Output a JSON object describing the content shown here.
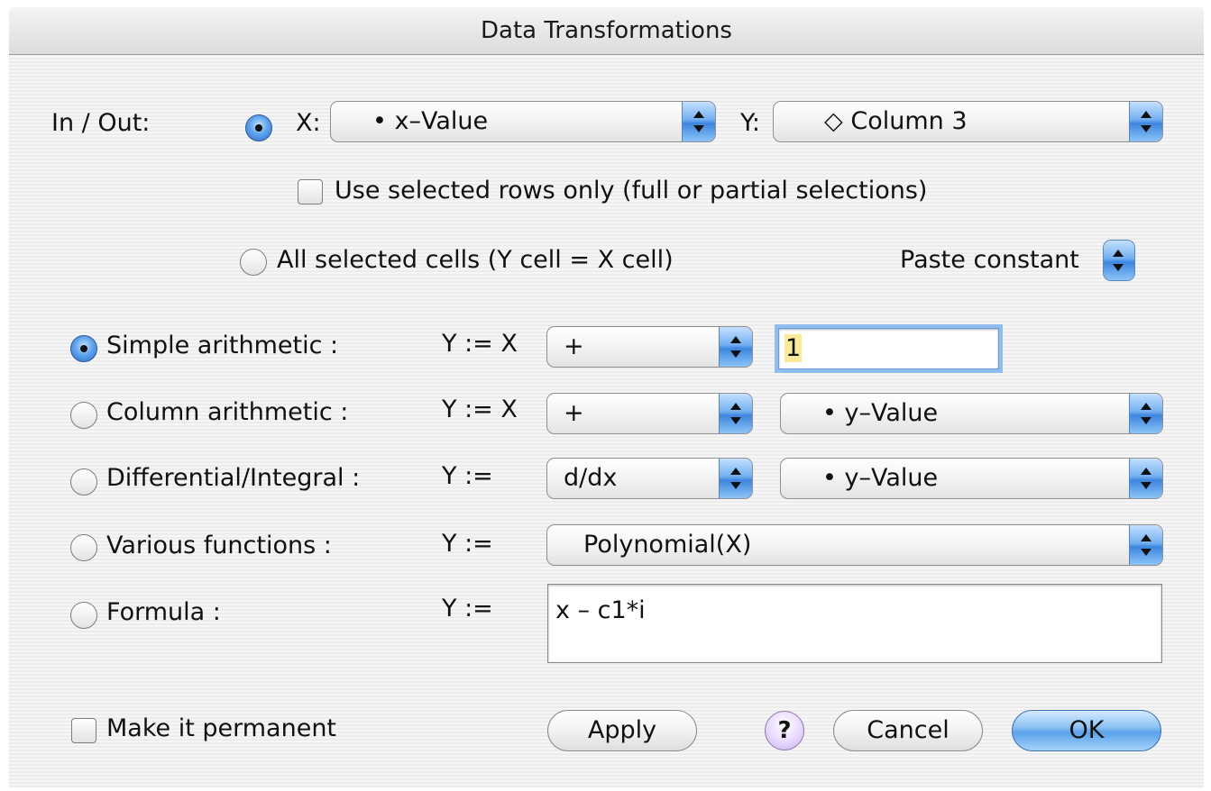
{
  "window": {
    "title": "Data Transformations"
  },
  "inout": {
    "label": "In / Out:",
    "x_label": "X:",
    "x_value": "• x–Value",
    "y_label": "Y:",
    "y_value": "◇ Column 3",
    "use_selected_label": "Use selected rows only  (full or partial selections)",
    "all_selected_label": "All selected cells   (Y cell = X cell)",
    "paste_constant_label": "Paste constant"
  },
  "ops": {
    "simple": {
      "label": "Simple arithmetic :",
      "expr": "Y := X",
      "operator": "+",
      "value": "1"
    },
    "column": {
      "label": "Column arithmetic :",
      "expr": "Y := X",
      "operator": "+",
      "column": "• y–Value"
    },
    "differential": {
      "label": "Differential/Integral :",
      "expr": "Y :=",
      "operator": "d/dx",
      "column": "• y–Value"
    },
    "various": {
      "label": "Various functions :",
      "expr": "Y :=",
      "function": "Polynomial(X)"
    },
    "formula": {
      "label": "Formula :",
      "expr": "Y :=",
      "text": "x – c1*i"
    }
  },
  "footer": {
    "permanent_label": "Make it permanent",
    "apply": "Apply",
    "help": "?",
    "cancel": "Cancel",
    "ok": "OK"
  }
}
